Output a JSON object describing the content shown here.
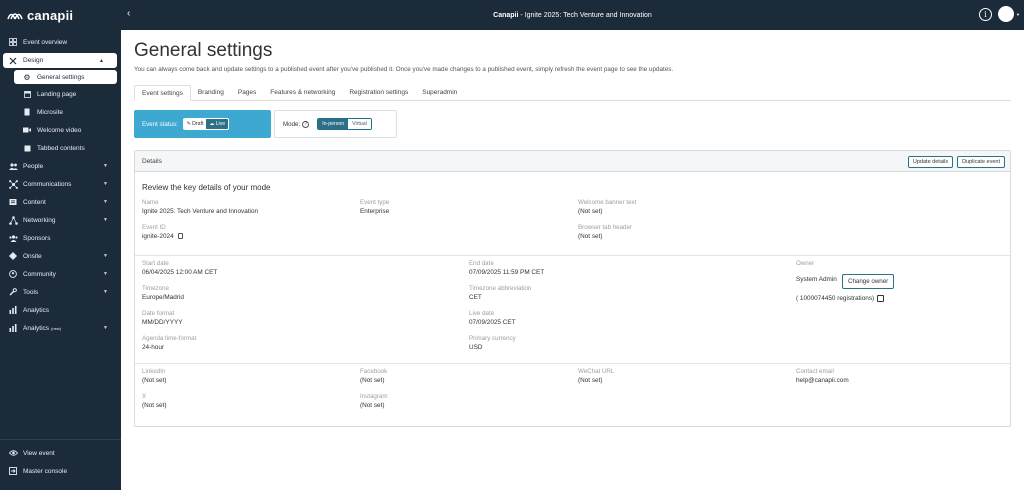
{
  "brand": {
    "name": "canapii"
  },
  "topbar": {
    "app": "Canapii",
    "separator": " - ",
    "event": "Ignite 2025: Tech Venture and Innovation"
  },
  "sidebar": {
    "items": [
      {
        "label": "Event overview",
        "icon": "grid-icon"
      },
      {
        "label": "Design",
        "icon": "design-icon"
      },
      {
        "label": "General settings",
        "icon": "gear-icon"
      },
      {
        "label": "Landing page",
        "icon": "landing-icon"
      },
      {
        "label": "Microsite",
        "icon": "document-icon"
      },
      {
        "label": "Welcome video",
        "icon": "video-icon"
      },
      {
        "label": "Tabbed contents",
        "icon": "table-icon"
      },
      {
        "label": "People",
        "icon": "people-icon"
      },
      {
        "label": "Communications",
        "icon": "network-icon"
      },
      {
        "label": "Content",
        "icon": "content-icon"
      },
      {
        "label": "Networking",
        "icon": "networking-icon"
      },
      {
        "label": "Sponsors",
        "icon": "sponsors-icon"
      },
      {
        "label": "Onsite",
        "icon": "onsite-icon"
      },
      {
        "label": "Community",
        "icon": "community-icon"
      },
      {
        "label": "Tools",
        "icon": "tools-icon"
      },
      {
        "label": "Analytics",
        "icon": "analytics-icon"
      },
      {
        "label": "Analytics",
        "badge": "(new)",
        "icon": "analytics-icon"
      }
    ],
    "bottom": [
      {
        "label": "View event",
        "icon": "eye-icon"
      },
      {
        "label": "Master console",
        "icon": "exit-icon"
      }
    ]
  },
  "page": {
    "title": "General settings",
    "intro": "You can always come back and update settings to a published event after you've published it. Once you've made changes to a published event, simply refresh the event page to see the updates."
  },
  "tabs": [
    "Event settings",
    "Branding",
    "Pages",
    "Features & networking",
    "Registration settings",
    "Superadmin"
  ],
  "status": {
    "label": "Event status:",
    "draft": "Draft",
    "live": "Live"
  },
  "mode": {
    "label": "Mode:",
    "in_person": "In-person",
    "virtual": "Virtual"
  },
  "details": {
    "header": "Details",
    "update_button": "Update details",
    "duplicate_button": "Duplicate event",
    "review_title": "Review the key details of your mode",
    "name_label": "Name",
    "name_value": "Ignite 2025: Tech Venture and Innovation",
    "type_label": "Event type",
    "type_value": "Enterprise",
    "banner_label": "Welcome banner text",
    "banner_value": "(Not set)",
    "id_label": "Event ID",
    "id_value": "ignite-2024",
    "browser_label": "Browser tab header",
    "browser_value": "(Not set)",
    "start_label": "Start date",
    "start_value": "06/04/2025 12:00 AM CET",
    "end_label": "End date",
    "end_value": "07/09/2025 11:59 PM CET",
    "owner_label": "Owner",
    "owner_value": "System Admin",
    "change_owner": "Change owner",
    "registrations": "( 1000074450 registrations)",
    "tz_label": "Timezone",
    "tz_value": "Europe/Madrid",
    "tzab_label": "Timezone abbreviation",
    "tzab_value": "CET",
    "datefmt_label": "Date format",
    "datefmt_value": "MM/DD/YYYY",
    "live_label": "Live date",
    "live_value": "07/09/2025 CET",
    "agenda_label": "Agenda time-format",
    "agenda_value": "24-hour",
    "currency_label": "Primary currency",
    "currency_value": "USD",
    "linkedin_label": "LinkedIn",
    "linkedin_value": "(Not set)",
    "facebook_label": "Facebook",
    "facebook_value": "(Not set)",
    "wechat_label": "WeChat URL",
    "wechat_value": "(Not set)",
    "email_label": "Contact email",
    "email_value": "help@canapii.com",
    "x_label": "X",
    "x_value": "(Not set)",
    "instagram_label": "Instagram",
    "instagram_value": "(Not set)"
  }
}
